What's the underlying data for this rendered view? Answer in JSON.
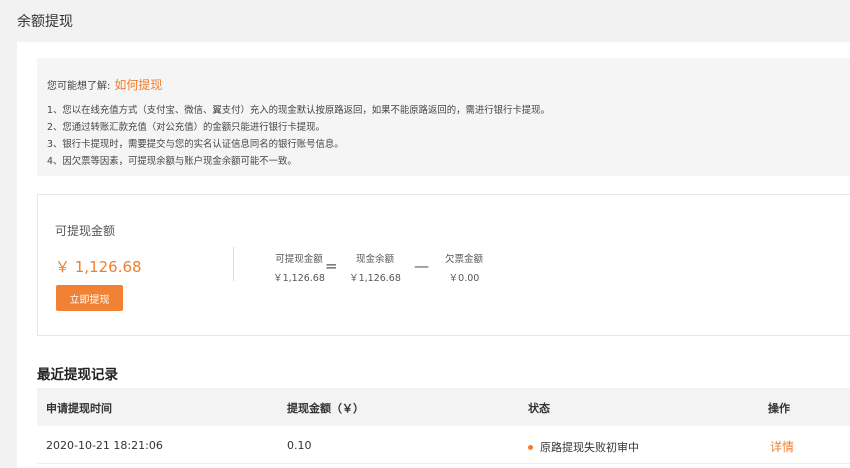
{
  "page": {
    "title": "余额提现"
  },
  "notice": {
    "prefix": "您可能想了解:",
    "link": "如何提现",
    "lines": [
      "1、您以在线充值方式（支付宝、微信、翼支付）充入的现金默认按原路返回，如果不能原路返回的，需进行银行卡提现。",
      "2、您通过转账汇款充值（对公充值）的金额只能进行银行卡提现。",
      "3、银行卡提现时，需要提交与您的实名认证信息同名的银行账号信息。",
      "4、因欠票等因素，可提现余额与账户现金余额可能不一致。"
    ]
  },
  "balance": {
    "label": "可提现金额",
    "amount": "￥ 1,126.68",
    "button": "立即提现",
    "equals": "=",
    "minus": "—",
    "breakdown": [
      {
        "label": "可提现金额",
        "value": "￥1,126.68"
      },
      {
        "label": "现金余额",
        "value": "￥1,126.68"
      },
      {
        "label": "欠票金额",
        "value": "￥0.00"
      }
    ]
  },
  "records": {
    "title": "最近提现记录",
    "columns": [
      "申请提现时间",
      "提现金额（￥）",
      "状态",
      "操作"
    ],
    "rows": [
      {
        "time": "2020-10-21 18:21:06",
        "amount": "0.10",
        "status": "原路提现失败初审中",
        "action": "详情"
      }
    ]
  },
  "colors": {
    "accent": "#f07e2f",
    "button": "#f28233"
  }
}
